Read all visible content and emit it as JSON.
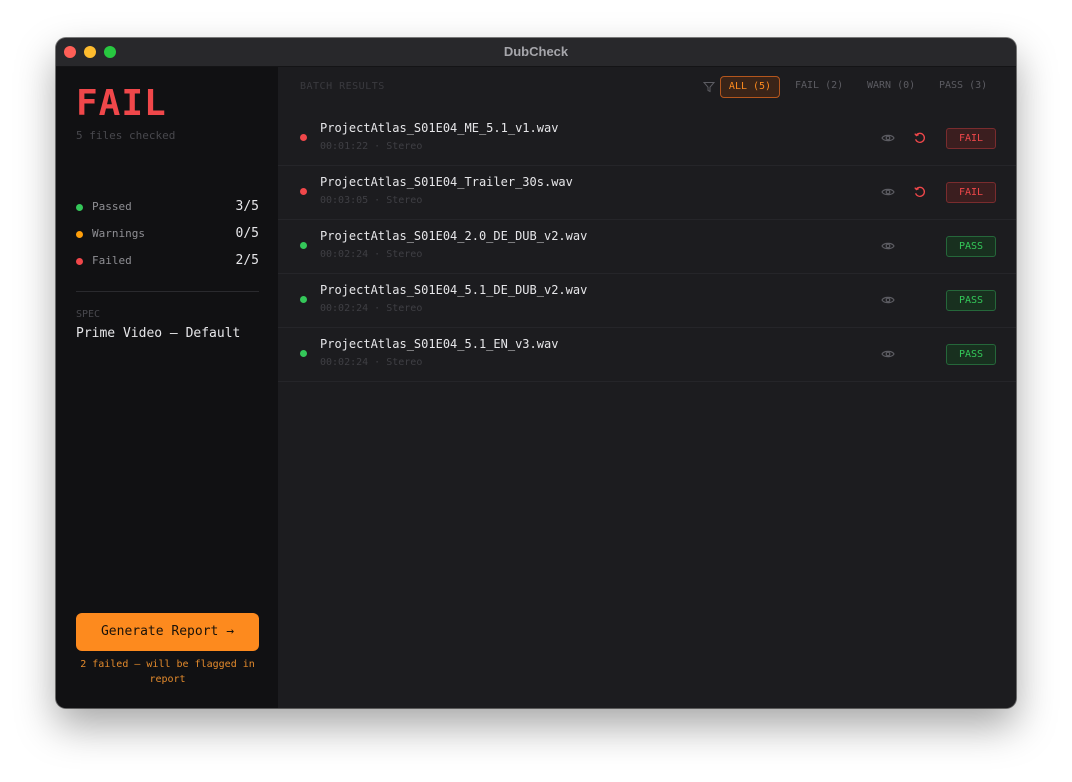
{
  "window": {
    "title": "DubCheck"
  },
  "sidebar": {
    "verdict": "FAIL",
    "files_checked": "5 files checked",
    "stats": [
      {
        "label": "Passed",
        "value": "3/5",
        "color": "#34c759"
      },
      {
        "label": "Warnings",
        "value": "0/5",
        "color": "#ff9f0a"
      },
      {
        "label": "Failed",
        "value": "2/5",
        "color": "#f0474a"
      }
    ],
    "spec_label": "SPEC",
    "spec_value": "Prime Video — Default",
    "generate_button": "Generate Report →",
    "generate_note": "2 failed — will be flagged in report"
  },
  "main": {
    "section_label": "BATCH RESULTS",
    "filter_icon": "filter-icon",
    "filters": [
      {
        "label": "ALL (5)",
        "active": true
      },
      {
        "label": "FAIL (2)",
        "active": false
      },
      {
        "label": "WARN (0)",
        "active": false
      },
      {
        "label": "PASS (3)",
        "active": false
      }
    ],
    "rows": [
      {
        "name": "ProjectAtlas_S01E04_ME_5.1_v1.wav",
        "meta": "00:01:22 · Stereo",
        "status": "FAIL"
      },
      {
        "name": "ProjectAtlas_S01E04_Trailer_30s.wav",
        "meta": "00:03:05 · Stereo",
        "status": "FAIL"
      },
      {
        "name": "ProjectAtlas_S01E04_2.0_DE_DUB_v2.wav",
        "meta": "00:02:24 · Stereo",
        "status": "PASS"
      },
      {
        "name": "ProjectAtlas_S01E04_5.1_DE_DUB_v2.wav",
        "meta": "00:02:24 · Stereo",
        "status": "PASS"
      },
      {
        "name": "ProjectAtlas_S01E04_5.1_EN_v3.wav",
        "meta": "00:02:24 · Stereo",
        "status": "PASS"
      }
    ]
  },
  "colors": {
    "accent": "#fd8a1e",
    "fail": "#f0474a",
    "pass": "#34c759",
    "warn": "#ff9f0a"
  }
}
